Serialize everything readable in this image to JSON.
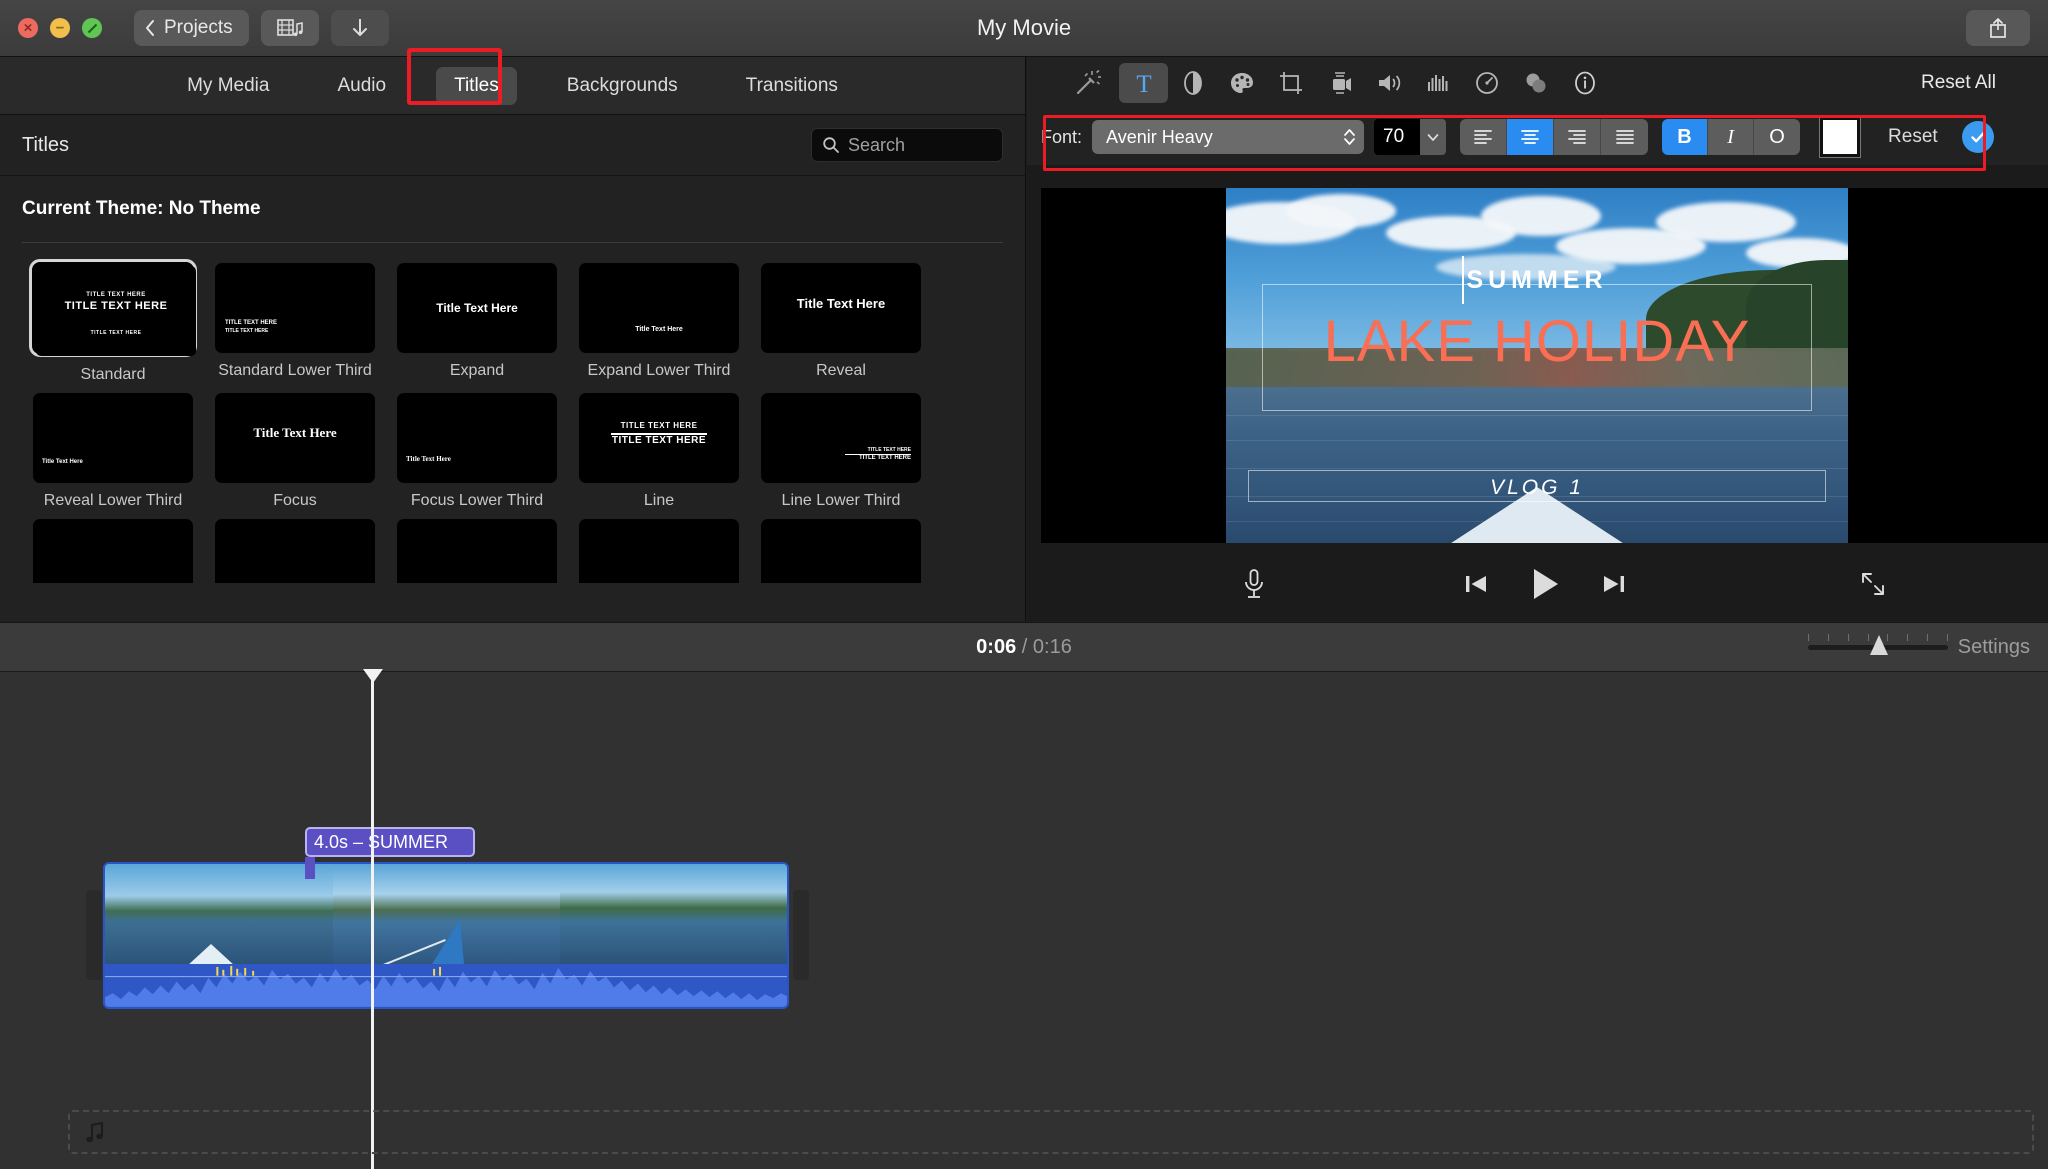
{
  "window": {
    "title": "My Movie",
    "traffic_lights": [
      "close",
      "minimize",
      "maximize"
    ],
    "back_button": "Projects",
    "media_button_icon": "film-music-icon",
    "download_button_icon": "download-arrow-icon",
    "share_button_icon": "share-icon"
  },
  "browser": {
    "tabs": [
      {
        "label": "My Media",
        "active": false
      },
      {
        "label": "Audio",
        "active": false
      },
      {
        "label": "Titles",
        "active": true
      },
      {
        "label": "Backgrounds",
        "active": false
      },
      {
        "label": "Transitions",
        "active": false
      }
    ],
    "panel_title": "Titles",
    "search": {
      "placeholder": "Search",
      "value": "",
      "icon": "search-icon"
    },
    "current_theme_label": "Current Theme: No Theme",
    "titles": [
      {
        "name": "Standard",
        "selected": true,
        "sample_lines": [
          "TITLE TEXT HERE",
          "TITLE TEXT HERE",
          "TITLE TEXT HERE"
        ]
      },
      {
        "name": "Standard Lower Third",
        "selected": false,
        "sample_lines": [
          "TITLE TEXT HERE",
          "TITLE TEXT HERE"
        ]
      },
      {
        "name": "Expand",
        "selected": false,
        "sample_lines": [
          "Title Text Here"
        ]
      },
      {
        "name": "Expand Lower Third",
        "selected": false,
        "sample_lines": [
          "Title Text Here"
        ]
      },
      {
        "name": "Reveal",
        "selected": false,
        "sample_lines": [
          "Title Text Here"
        ]
      },
      {
        "name": "Reveal Lower Third",
        "selected": false,
        "sample_lines": [
          "Title Text Here"
        ]
      },
      {
        "name": "Focus",
        "selected": false,
        "sample_lines": [
          "Title Text Here"
        ]
      },
      {
        "name": "Focus Lower Third",
        "selected": false,
        "sample_lines": [
          "Title Text Here"
        ]
      },
      {
        "name": "Line",
        "selected": false,
        "sample_lines": [
          "TITLE TEXT HERE",
          "TITLE TEXT HERE"
        ]
      },
      {
        "name": "Line Lower Third",
        "selected": false,
        "sample_lines": [
          "TITLE TEXT HERE",
          "TITLE TEXT HERE"
        ]
      }
    ]
  },
  "inspector": {
    "tools": [
      {
        "name": "magic-wand-icon",
        "active": false
      },
      {
        "name": "title-text-icon",
        "active": true
      },
      {
        "name": "color-balance-icon",
        "active": false
      },
      {
        "name": "color-correction-icon",
        "active": false
      },
      {
        "name": "crop-icon",
        "active": false
      },
      {
        "name": "stabilization-icon",
        "active": false
      },
      {
        "name": "volume-icon",
        "active": false
      },
      {
        "name": "noise-reduction-icon",
        "active": false
      },
      {
        "name": "speed-icon",
        "active": false
      },
      {
        "name": "clip-filter-icon",
        "active": false
      },
      {
        "name": "info-icon",
        "active": false
      }
    ],
    "reset_all_label": "Reset All",
    "font_controls": {
      "font_label": "Font:",
      "font_family": "Avenir Heavy",
      "font_size": "70",
      "alignment": [
        "left",
        "center",
        "right",
        "justify"
      ],
      "alignment_active": "center",
      "styles": [
        {
          "label": "B",
          "name": "bold",
          "active": true
        },
        {
          "label": "I",
          "name": "italic",
          "active": false
        },
        {
          "label": "O",
          "name": "outline",
          "active": false
        }
      ],
      "color": "#ffffff",
      "reset_label": "Reset",
      "confirm_icon": "checkmark-icon"
    }
  },
  "viewer": {
    "overlay_title": "SUMMER",
    "overlay_main": "LAKE HOLIDAY",
    "overlay_subtitle": "VLOG 1",
    "main_color": "#fa6e54",
    "title_color": "#ffffff",
    "controls": {
      "record_voiceover_icon": "microphone-icon",
      "previous_icon": "skip-back-icon",
      "play_icon": "play-icon",
      "next_icon": "skip-forward-icon",
      "fullscreen_icon": "fullscreen-icon"
    }
  },
  "timeline": {
    "current_time": "0:06",
    "separator": "/",
    "total_time": "0:16",
    "settings_label": "Settings",
    "zoom_value": 45,
    "title_clip_label": "4.0s – SUMMER",
    "music_dropzone_icon": "music-note-icon"
  }
}
